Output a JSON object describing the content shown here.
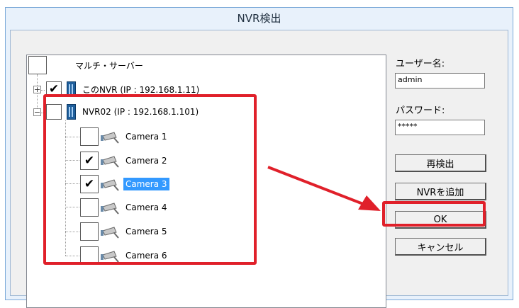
{
  "window": {
    "title": "NVR検出"
  },
  "tree": {
    "root": {
      "label": "マルチ・サーバー",
      "checked": false
    },
    "nvrs": [
      {
        "label": "このNVR (IP : 192.168.1.11)",
        "checked": true,
        "expander": "+"
      },
      {
        "label": "NVR02 (IP : 192.168.1.101)",
        "checked": false,
        "expander": "−"
      }
    ],
    "cameras": [
      {
        "label": "Camera 1",
        "checked": false,
        "selected": false
      },
      {
        "label": "Camera 2",
        "checked": true,
        "selected": false
      },
      {
        "label": "Camera 3",
        "checked": true,
        "selected": true
      },
      {
        "label": "Camera 4",
        "checked": false,
        "selected": false
      },
      {
        "label": "Camera 5",
        "checked": false,
        "selected": false
      },
      {
        "label": "Camera 6",
        "checked": false,
        "selected": false
      }
    ],
    "check_glyph": "✔"
  },
  "form": {
    "username_label": "ユーザー名:",
    "username_value": "admin",
    "password_label": "パスワード:",
    "password_value": "*****"
  },
  "buttons": {
    "rescan": "再検出",
    "add_nvr": "NVRを追加",
    "ok": "OK",
    "cancel": "キャンセル"
  },
  "colors": {
    "highlight": "#e0202a",
    "selection": "#3399ff"
  },
  "icons": {
    "nvr": "nvr-server-icon",
    "camera": "security-camera-icon",
    "expand": "expand-plus-icon",
    "collapse": "collapse-minus-icon"
  }
}
